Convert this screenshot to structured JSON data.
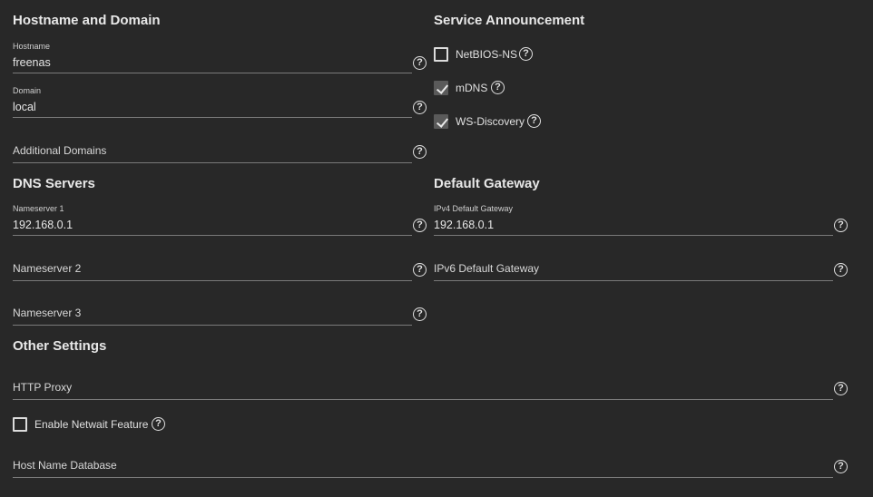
{
  "sections": {
    "hostname_domain": "Hostname and Domain",
    "service_announcement": "Service Announcement",
    "dns_servers": "DNS Servers",
    "default_gateway": "Default Gateway",
    "other_settings": "Other Settings"
  },
  "hostname": {
    "label": "Hostname",
    "value": "freenas"
  },
  "domain": {
    "label": "Domain",
    "value": "local"
  },
  "additional_domains": {
    "placeholder": "Additional Domains"
  },
  "service": {
    "netbios": {
      "label": "NetBIOS-NS",
      "checked": false
    },
    "mdns": {
      "label": "mDNS",
      "checked": true
    },
    "wsdiscovery": {
      "label": "WS-Discovery",
      "checked": true
    }
  },
  "nameserver1": {
    "label": "Nameserver 1",
    "value": "192.168.0.1"
  },
  "nameserver2": {
    "placeholder": "Nameserver 2"
  },
  "nameserver3": {
    "placeholder": "Nameserver 3"
  },
  "ipv4_gateway": {
    "label": "IPv4 Default Gateway",
    "value": "192.168.0.1"
  },
  "ipv6_gateway": {
    "placeholder": "IPv6 Default Gateway"
  },
  "http_proxy": {
    "placeholder": "HTTP Proxy"
  },
  "netwait": {
    "label": "Enable Netwait Feature",
    "checked": false
  },
  "host_name_database": {
    "placeholder": "Host Name Database"
  },
  "help_glyph": "?"
}
